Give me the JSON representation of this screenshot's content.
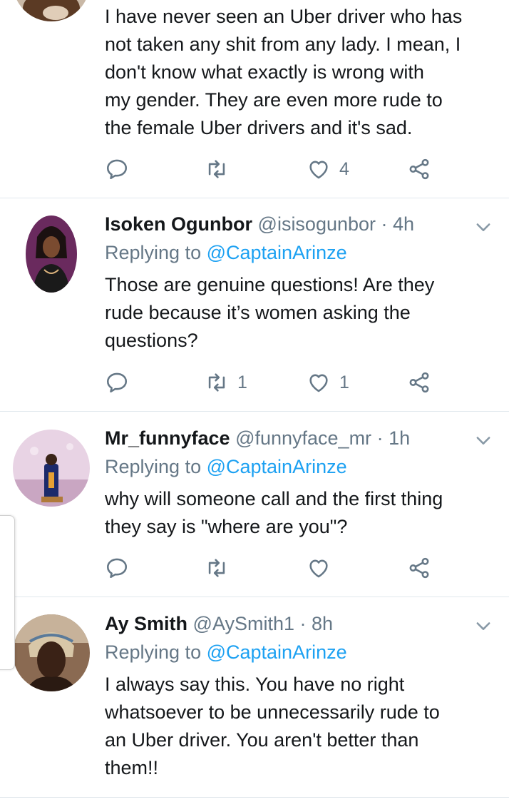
{
  "tweets": [
    {
      "name": "",
      "handle": "",
      "time": "",
      "replying_prefix": "",
      "replying_to": "",
      "text": "I have never seen an Uber driver who has\nnot taken any shit from any lady. I mean, I\ndon't know what exactly is wrong with\nmy gender. They are even more rude to\nthe female Uber drivers and it's sad.",
      "reply_count": "",
      "retweet_count": "",
      "like_count": "4"
    },
    {
      "name": "Isoken Ogunbor",
      "handle": "@isisogunbor",
      "time": "· 4h",
      "replying_prefix": "Replying to ",
      "replying_to": "@CaptainArinze",
      "text": "Those are genuine questions! Are they\nrude because it’s women asking the\nquestions?",
      "reply_count": "",
      "retweet_count": "1",
      "like_count": "1"
    },
    {
      "name": "Mr_funnyface",
      "handle": "@funnyface_mr",
      "time": "· 1h",
      "replying_prefix": "Replying to ",
      "replying_to": "@CaptainArinze",
      "text": "why will someone call and the first thing\nthey say is \"where are you\"?",
      "reply_count": "",
      "retweet_count": "",
      "like_count": ""
    },
    {
      "name": "Ay Smith",
      "handle": "@AySmith1",
      "time": "· 8h",
      "replying_prefix": "Replying to ",
      "replying_to": "@CaptainArinze",
      "text": "I always say this. You have no right\nwhatsoever to be unnecessarily rude to\nan Uber driver. You aren't better than\nthem!!",
      "reply_count": "",
      "retweet_count": "",
      "like_count": ""
    }
  ],
  "colors": {
    "text": "#14171a",
    "secondary": "#657786",
    "link": "#1da1f2",
    "divider": "#e1e8ed"
  },
  "icons": {
    "reply": "reply-icon",
    "retweet": "retweet-icon",
    "like": "heart-icon",
    "share": "share-icon",
    "caret": "chevron-down-icon"
  }
}
